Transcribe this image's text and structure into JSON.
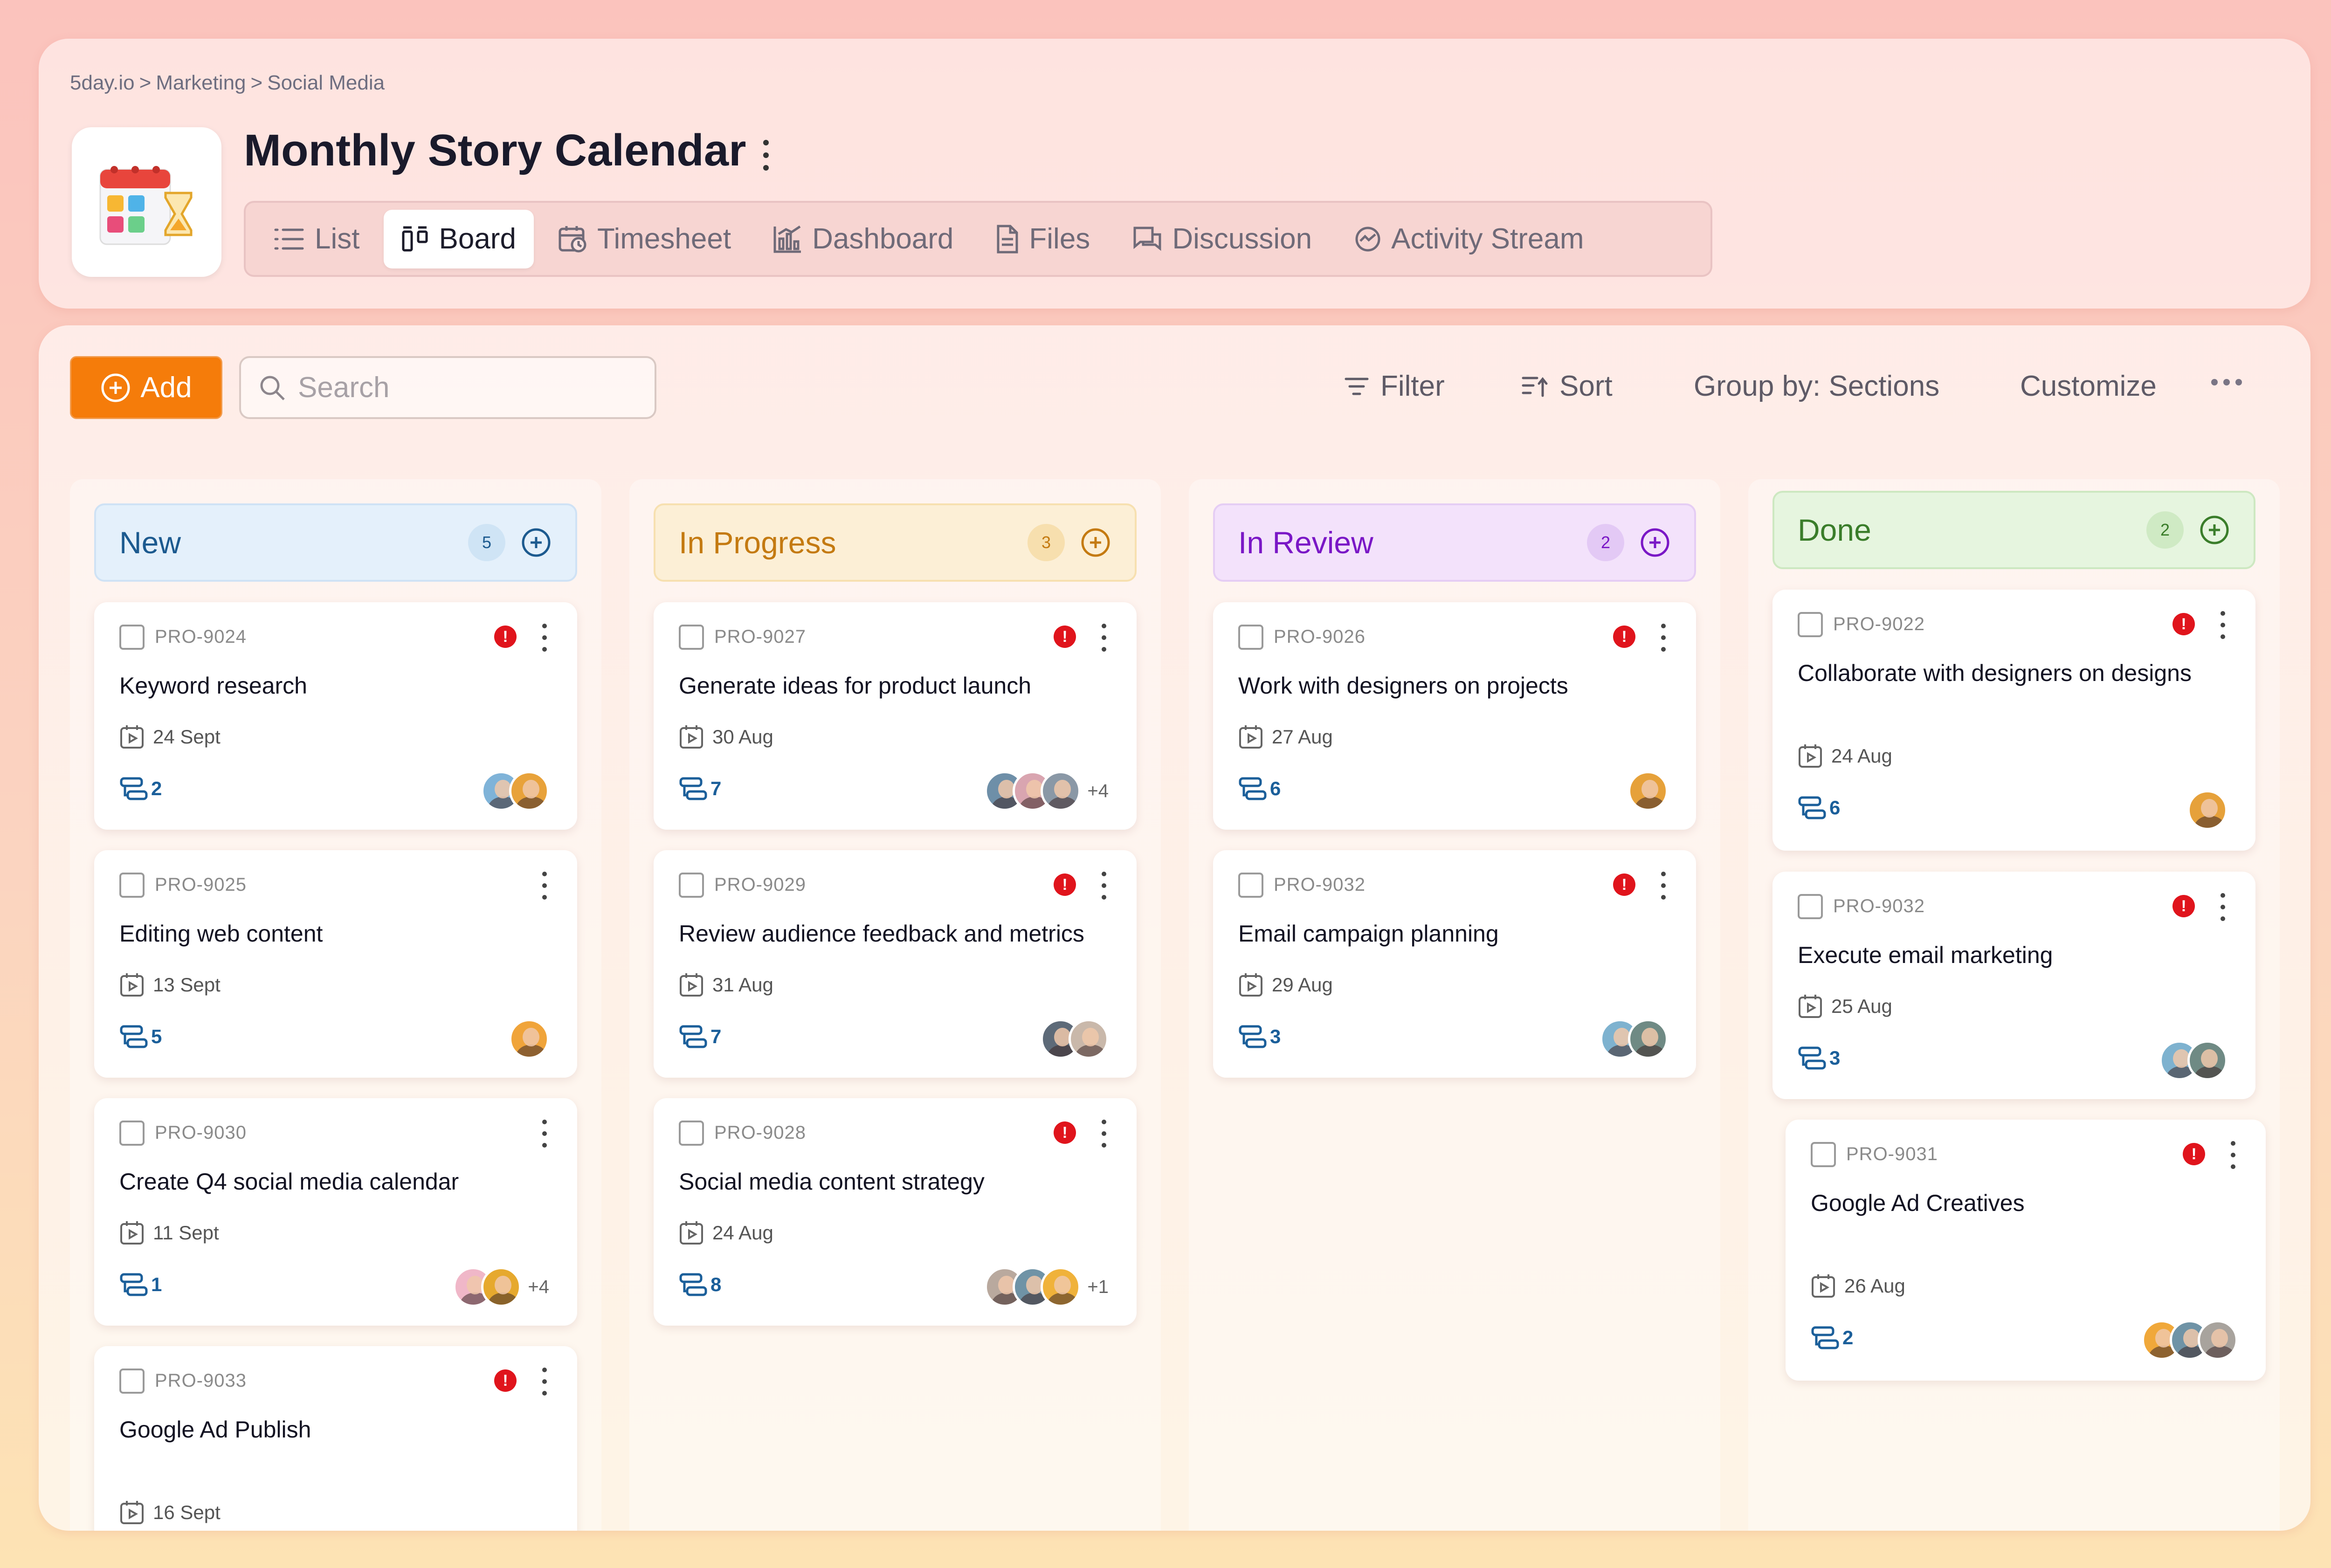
{
  "breadcrumb": [
    "5day.io",
    ">",
    "Marketing",
    ">",
    "Social Media"
  ],
  "page": {
    "title": "Monthly Story Calendar"
  },
  "tabs": [
    {
      "label": "List",
      "icon": "list-icon"
    },
    {
      "label": "Board",
      "icon": "board-icon",
      "active": true
    },
    {
      "label": "Timesheet",
      "icon": "timesheet-icon"
    },
    {
      "label": "Dashboard",
      "icon": "chart-icon"
    },
    {
      "label": "Files",
      "icon": "file-icon"
    },
    {
      "label": "Discussion",
      "icon": "discussion-icon"
    },
    {
      "label": "Activity Stream",
      "icon": "activity-icon"
    }
  ],
  "toolbar": {
    "add_label": "Add",
    "search_placeholder": "Search",
    "filter_label": "Filter",
    "sort_label": "Sort",
    "group_label": "Group by: Sections",
    "customize_label": "Customize"
  },
  "colors": {
    "accent": "#f57c0a",
    "priority": "#e0141c",
    "new": "#1c5a8f",
    "in_progress": "#c47a11",
    "in_review": "#7a17c6",
    "done": "#3a7d2a"
  },
  "columns": [
    {
      "name": "New",
      "count": "5",
      "cards": [
        {
          "id": "PRO-9024",
          "title": "Keyword research",
          "date": "24 Sept",
          "subtasks": "2",
          "priority": true,
          "avatars": 2,
          "more": ""
        },
        {
          "id": "PRO-9025",
          "title": "Editing web content",
          "date": "13 Sept",
          "subtasks": "5",
          "priority": false,
          "avatars": 1,
          "more": ""
        },
        {
          "id": "PRO-9030",
          "title": "Create Q4 social media calendar",
          "date": "11 Sept",
          "subtasks": "1",
          "priority": false,
          "avatars": 2,
          "more": "+4"
        },
        {
          "id": "PRO-9033",
          "title": "Google Ad Publish",
          "date": "16 Sept",
          "subtasks": "",
          "priority": true,
          "avatars": 0,
          "more": ""
        }
      ]
    },
    {
      "name": "In Progress",
      "count": "3",
      "cards": [
        {
          "id": "PRO-9027",
          "title": "Generate ideas for product launch",
          "date": "30 Aug",
          "subtasks": "7",
          "priority": true,
          "avatars": 3,
          "more": "+4"
        },
        {
          "id": "PRO-9029",
          "title": "Review audience feedback and metrics",
          "date": "31 Aug",
          "subtasks": "7",
          "priority": true,
          "avatars": 2,
          "more": ""
        },
        {
          "id": "PRO-9028",
          "title": "Social media content strategy",
          "date": "24 Aug",
          "subtasks": "8",
          "priority": true,
          "avatars": 3,
          "more": "+1"
        }
      ]
    },
    {
      "name": "In Review",
      "count": "2",
      "cards": [
        {
          "id": "PRO-9026",
          "title": "Work with designers on projects",
          "date": "27 Aug",
          "subtasks": "6",
          "priority": true,
          "avatars": 1,
          "more": ""
        },
        {
          "id": "PRO-9032",
          "title": "Email campaign planning",
          "date": "29 Aug",
          "subtasks": "3",
          "priority": true,
          "avatars": 2,
          "more": ""
        }
      ]
    },
    {
      "name": "Done",
      "count": "2",
      "cards": [
        {
          "id": "PRO-9022",
          "title": "Collaborate with designers on designs",
          "date": "24 Aug",
          "subtasks": "6",
          "priority": true,
          "avatars": 1,
          "more": ""
        },
        {
          "id": "PRO-9032",
          "title": "Execute email marketing",
          "date": "25 Aug",
          "subtasks": "3",
          "priority": true,
          "avatars": 2,
          "more": ""
        },
        {
          "id": "PRO-9031",
          "title": "Google Ad Creatives",
          "date": "26 Aug",
          "subtasks": "2",
          "priority": true,
          "avatars": 3,
          "more": ""
        }
      ]
    }
  ]
}
